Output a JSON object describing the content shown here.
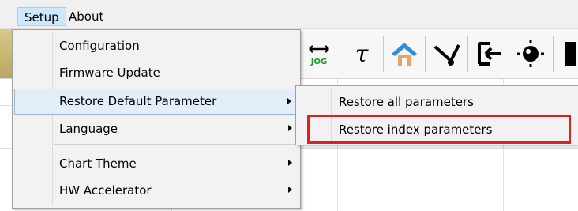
{
  "menubar": {
    "items": [
      {
        "label": "Setup"
      },
      {
        "label": "About"
      }
    ]
  },
  "toolbar": {
    "jog_label": "JOG",
    "tau_symbol": "τ"
  },
  "setup_menu": {
    "items": [
      {
        "label": "Configuration"
      },
      {
        "label": "Firmware Update"
      },
      {
        "label": "Restore Default Parameter"
      },
      {
        "label": "Language"
      },
      {
        "label": "Chart Theme"
      },
      {
        "label": "HW Accelerator"
      }
    ]
  },
  "restore_submenu": {
    "items": [
      {
        "label": "Restore all parameters"
      },
      {
        "label": "Restore index parameters"
      }
    ]
  },
  "colors": {
    "highlight_box": "#e02020",
    "home_icon": "#2f8fd8"
  }
}
